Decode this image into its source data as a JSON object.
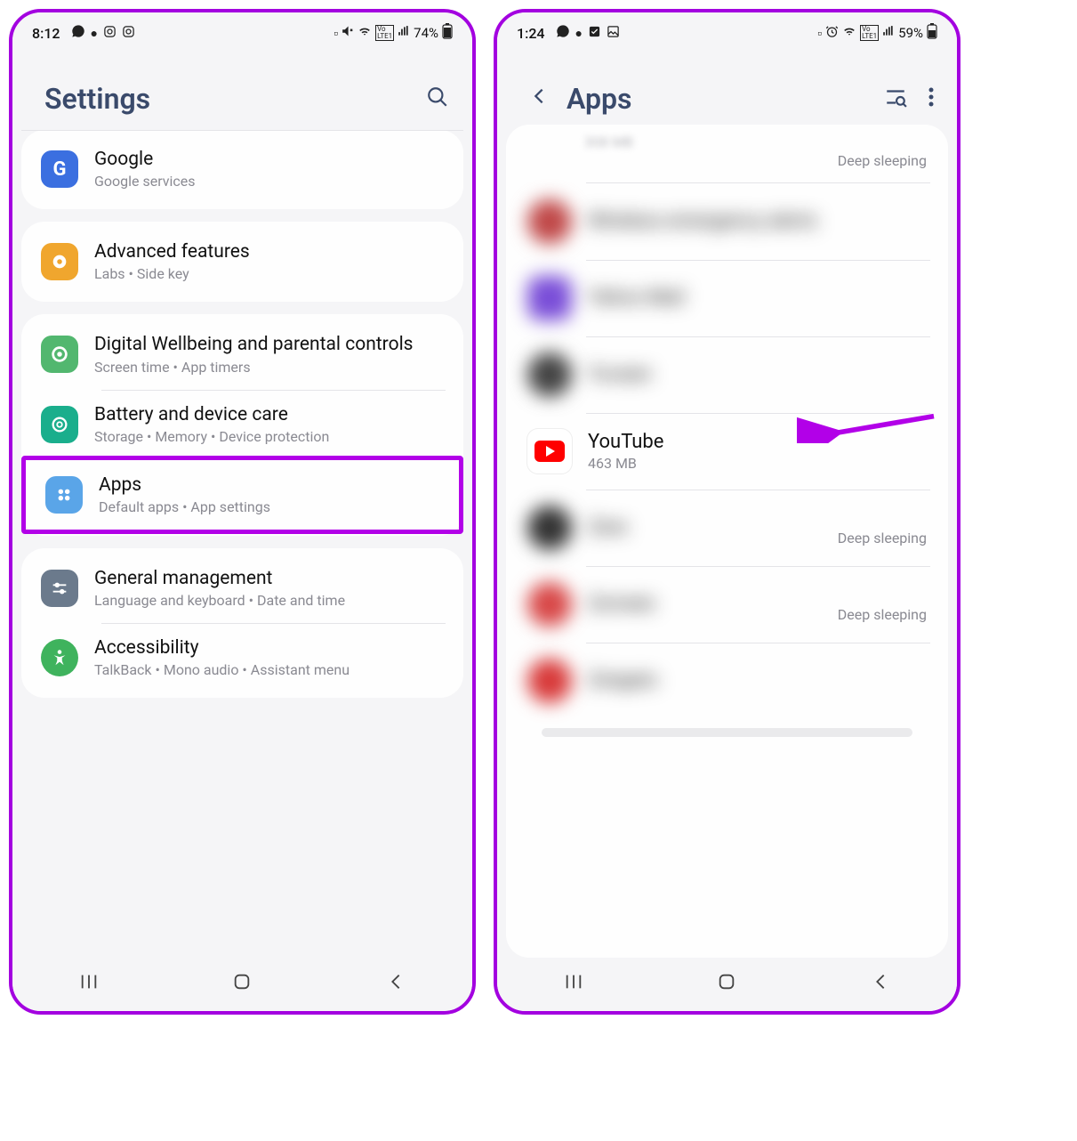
{
  "left": {
    "status": {
      "time": "8:12",
      "battery": "74%"
    },
    "header": {
      "title": "Settings"
    },
    "items": [
      {
        "title": "Google",
        "sub": "Google services",
        "icon_bg": "#3b6fe0",
        "icon_name": "google-icon"
      },
      {
        "title": "Advanced features",
        "sub": "Labs  •  Side key",
        "icon_bg": "#f0a62e",
        "icon_name": "advanced-icon"
      },
      {
        "title": "Digital Wellbeing and parental controls",
        "sub": "Screen time  •  App timers",
        "icon_bg": "#52b76f",
        "icon_name": "wellbeing-icon"
      },
      {
        "title": "Battery and device care",
        "sub": "Storage  •  Memory  •  Device protection",
        "icon_bg": "#1aae8c",
        "icon_name": "battery-care-icon"
      },
      {
        "title": "Apps",
        "sub": "Default apps  •  App settings",
        "icon_bg": "#5aa5e8",
        "icon_name": "apps-icon",
        "highlight": true
      },
      {
        "title": "General management",
        "sub": "Language and keyboard  •  Date and time",
        "icon_bg": "#6b7a8c",
        "icon_name": "general-icon"
      },
      {
        "title": "Accessibility",
        "sub": "TalkBack  •  Mono audio  •  Assistant menu",
        "icon_bg": "#3fb35d",
        "icon_name": "accessibility-icon"
      }
    ]
  },
  "right": {
    "status": {
      "time": "1:24",
      "battery": "59%"
    },
    "header": {
      "title": "Apps"
    },
    "partial_top": {
      "sub": "308 MB",
      "status": "Deep sleeping"
    },
    "apps": [
      {
        "title": "Wireless emergency alerts",
        "sub": "",
        "icon_bg": "#c04848",
        "blurred": true
      },
      {
        "title": "Yahoo Mail",
        "sub": "",
        "icon_bg": "#7a4ed8",
        "blurred": true
      },
      {
        "title": "Yuvaan",
        "sub": "",
        "icon_bg": "#444444",
        "blurred": true
      },
      {
        "title": "YouTube",
        "sub": "463 MB",
        "icon_bg": "#ffffff",
        "blurred": false,
        "youtube": true
      },
      {
        "title": "Zara",
        "sub": "",
        "icon_bg": "#333333",
        "blurred": true,
        "status": "Deep sleeping"
      },
      {
        "title": "Zomato",
        "sub": "",
        "icon_bg": "#d84848",
        "blurred": true,
        "status": "Deep sleeping"
      },
      {
        "title": "Zwigato",
        "sub": "",
        "icon_bg": "#d83a3a",
        "blurred": true
      }
    ]
  }
}
